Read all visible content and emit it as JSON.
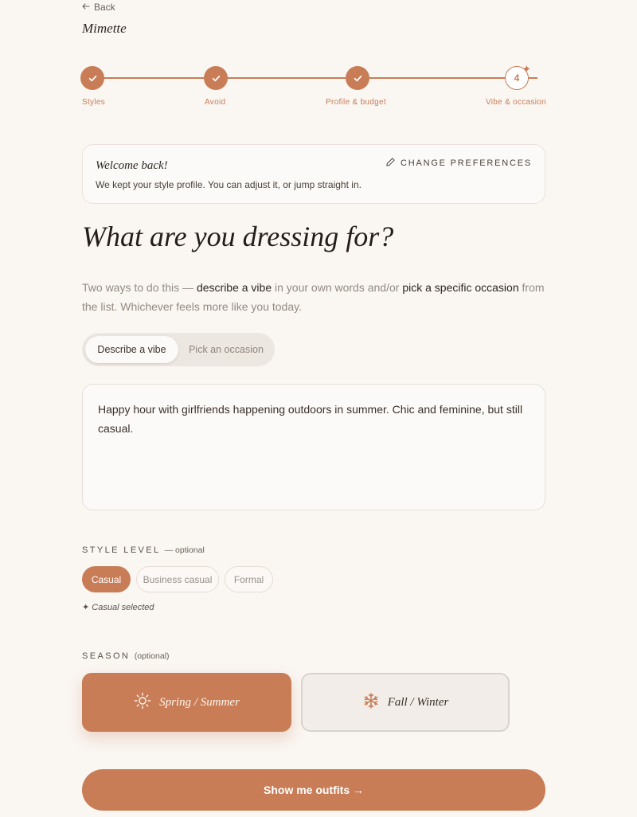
{
  "nav": {
    "back_label": "Back",
    "brand": "Mimette"
  },
  "stepper": {
    "steps": [
      {
        "label": "Styles",
        "state": "done"
      },
      {
        "label": "Avoid",
        "state": "done"
      },
      {
        "label": "Profile & budget",
        "state": "done"
      },
      {
        "label": "Vibe & occasion",
        "state": "current",
        "number": "4"
      }
    ]
  },
  "welcome": {
    "title": "Welcome back!",
    "text": "We kept your style profile. You can adjust it, or jump straight in.",
    "change_label": "CHANGE PREFERENCES"
  },
  "heading": "What are you dressing for?",
  "intro": {
    "part1": "Two ways to do this — ",
    "em1": "describe a vibe",
    "part2": " in your own words and/or ",
    "em2": "pick a specific occasion",
    "part3": " from the list. Whichever feels more like you today."
  },
  "mode_tabs": {
    "active": "Describe a vibe",
    "inactive": "Pick an occasion"
  },
  "vibe_input": {
    "value": "Happy hour with girlfriends happening outdoors in summer. Chic and feminine, but still casual."
  },
  "style_level": {
    "label": "STYLE LEVEL",
    "optional": "— optional",
    "options": [
      "Casual",
      "Business casual",
      "Formal"
    ],
    "selected": "Casual",
    "note": "✦ Casual selected"
  },
  "season": {
    "label": "SEASON",
    "optional": "(optional)",
    "options": [
      "Spring / Summer",
      "Fall / Winter"
    ],
    "selected": "Spring / Summer"
  },
  "cta_label": "Show me outfits →",
  "colors": {
    "accent": "#c87d57",
    "background": "#faf6f2"
  }
}
